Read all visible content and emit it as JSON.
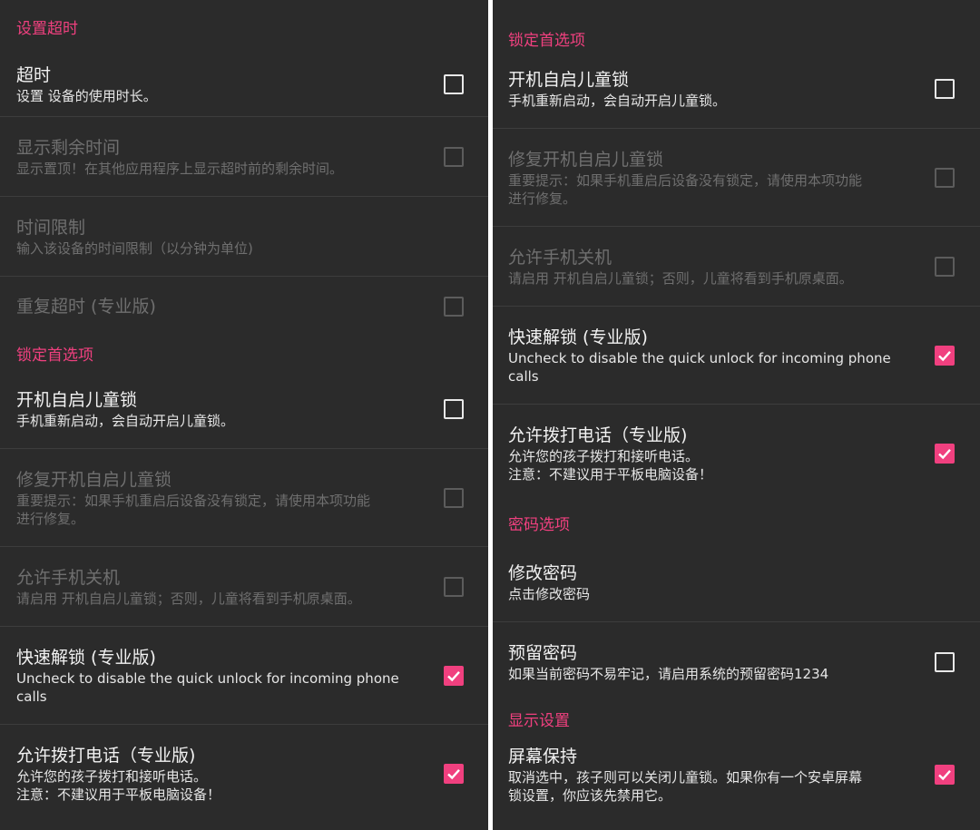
{
  "left": {
    "section_timeout": "设置超时",
    "timeout": {
      "title": "超时",
      "summary": "设置 设备的使用时长。",
      "checked": false
    },
    "show_remaining": {
      "title": "显示剩余时间",
      "summary": "显示置顶！在其他应用程序上显示超时前的剩余时间。",
      "checked": false,
      "enabled": false
    },
    "time_limit": {
      "title": "时间限制",
      "summary": "输入该设备的时间限制（以分钟为单位)",
      "enabled": false
    },
    "repeat_timeout": {
      "title": "重复超时 (专业版)",
      "checked": false,
      "enabled": false
    },
    "section_lock": "锁定首选项",
    "boot_lock": {
      "title": "开机自启儿童锁",
      "summary": "手机重新启动，会自动开启儿童锁。",
      "checked": false
    },
    "repair_boot": {
      "title": "修复开机自启儿童锁",
      "summary": "重要提示：如果手机重启后设备没有锁定，请使用本项功能\n进行修复。",
      "checked": false,
      "enabled": false
    },
    "allow_shutdown": {
      "title": "允许手机关机",
      "summary": "请启用 开机自启儿童锁；否则，儿童将看到手机原桌面。",
      "checked": false,
      "enabled": false
    },
    "quick_unlock": {
      "title": "快速解锁 (专业版)",
      "summary": "Uncheck to disable the quick unlock for incoming phone\ncalls",
      "checked": true
    },
    "allow_calls": {
      "title": "允许拨打电话（专业版)",
      "summary": "允许您的孩子拨打和接听电话。\n注意：不建议用于平板电脑设备！",
      "checked": true
    }
  },
  "right": {
    "section_lock": "锁定首选项",
    "boot_lock": {
      "title": "开机自启儿童锁",
      "summary": "手机重新启动，会自动开启儿童锁。",
      "checked": false
    },
    "repair_boot": {
      "title": "修复开机自启儿童锁",
      "summary": "重要提示：如果手机重启后设备没有锁定，请使用本项功能\n进行修复。",
      "checked": false,
      "enabled": false
    },
    "allow_shutdown": {
      "title": "允许手机关机",
      "summary": "请启用 开机自启儿童锁；否则，儿童将看到手机原桌面。",
      "checked": false,
      "enabled": false
    },
    "quick_unlock": {
      "title": "快速解锁 (专业版)",
      "summary": "Uncheck to disable the quick unlock for incoming phone\ncalls",
      "checked": true
    },
    "allow_calls": {
      "title": "允许拨打电话（专业版)",
      "summary": "允许您的孩子拨打和接听电话。\n注意：不建议用于平板电脑设备！",
      "checked": true
    },
    "section_password": "密码选项",
    "change_password": {
      "title": "修改密码",
      "summary": "点击修改密码"
    },
    "reserved_password": {
      "title": "预留密码",
      "summary": "如果当前密码不易牢记，请启用系统的预留密码1234",
      "checked": false
    },
    "section_display": "显示设置",
    "screen_keep": {
      "title": "屏幕保持",
      "summary": "取消选中，孩子则可以关闭儿童锁。如果你有一个安卓屏幕\n锁设置，你应该先禁用它。",
      "checked": true
    }
  },
  "colors": {
    "accent": "#f0407f",
    "background": "#2b2b2b",
    "divider": "#3d3d3d",
    "disabled_text": "#6f6f6f"
  }
}
